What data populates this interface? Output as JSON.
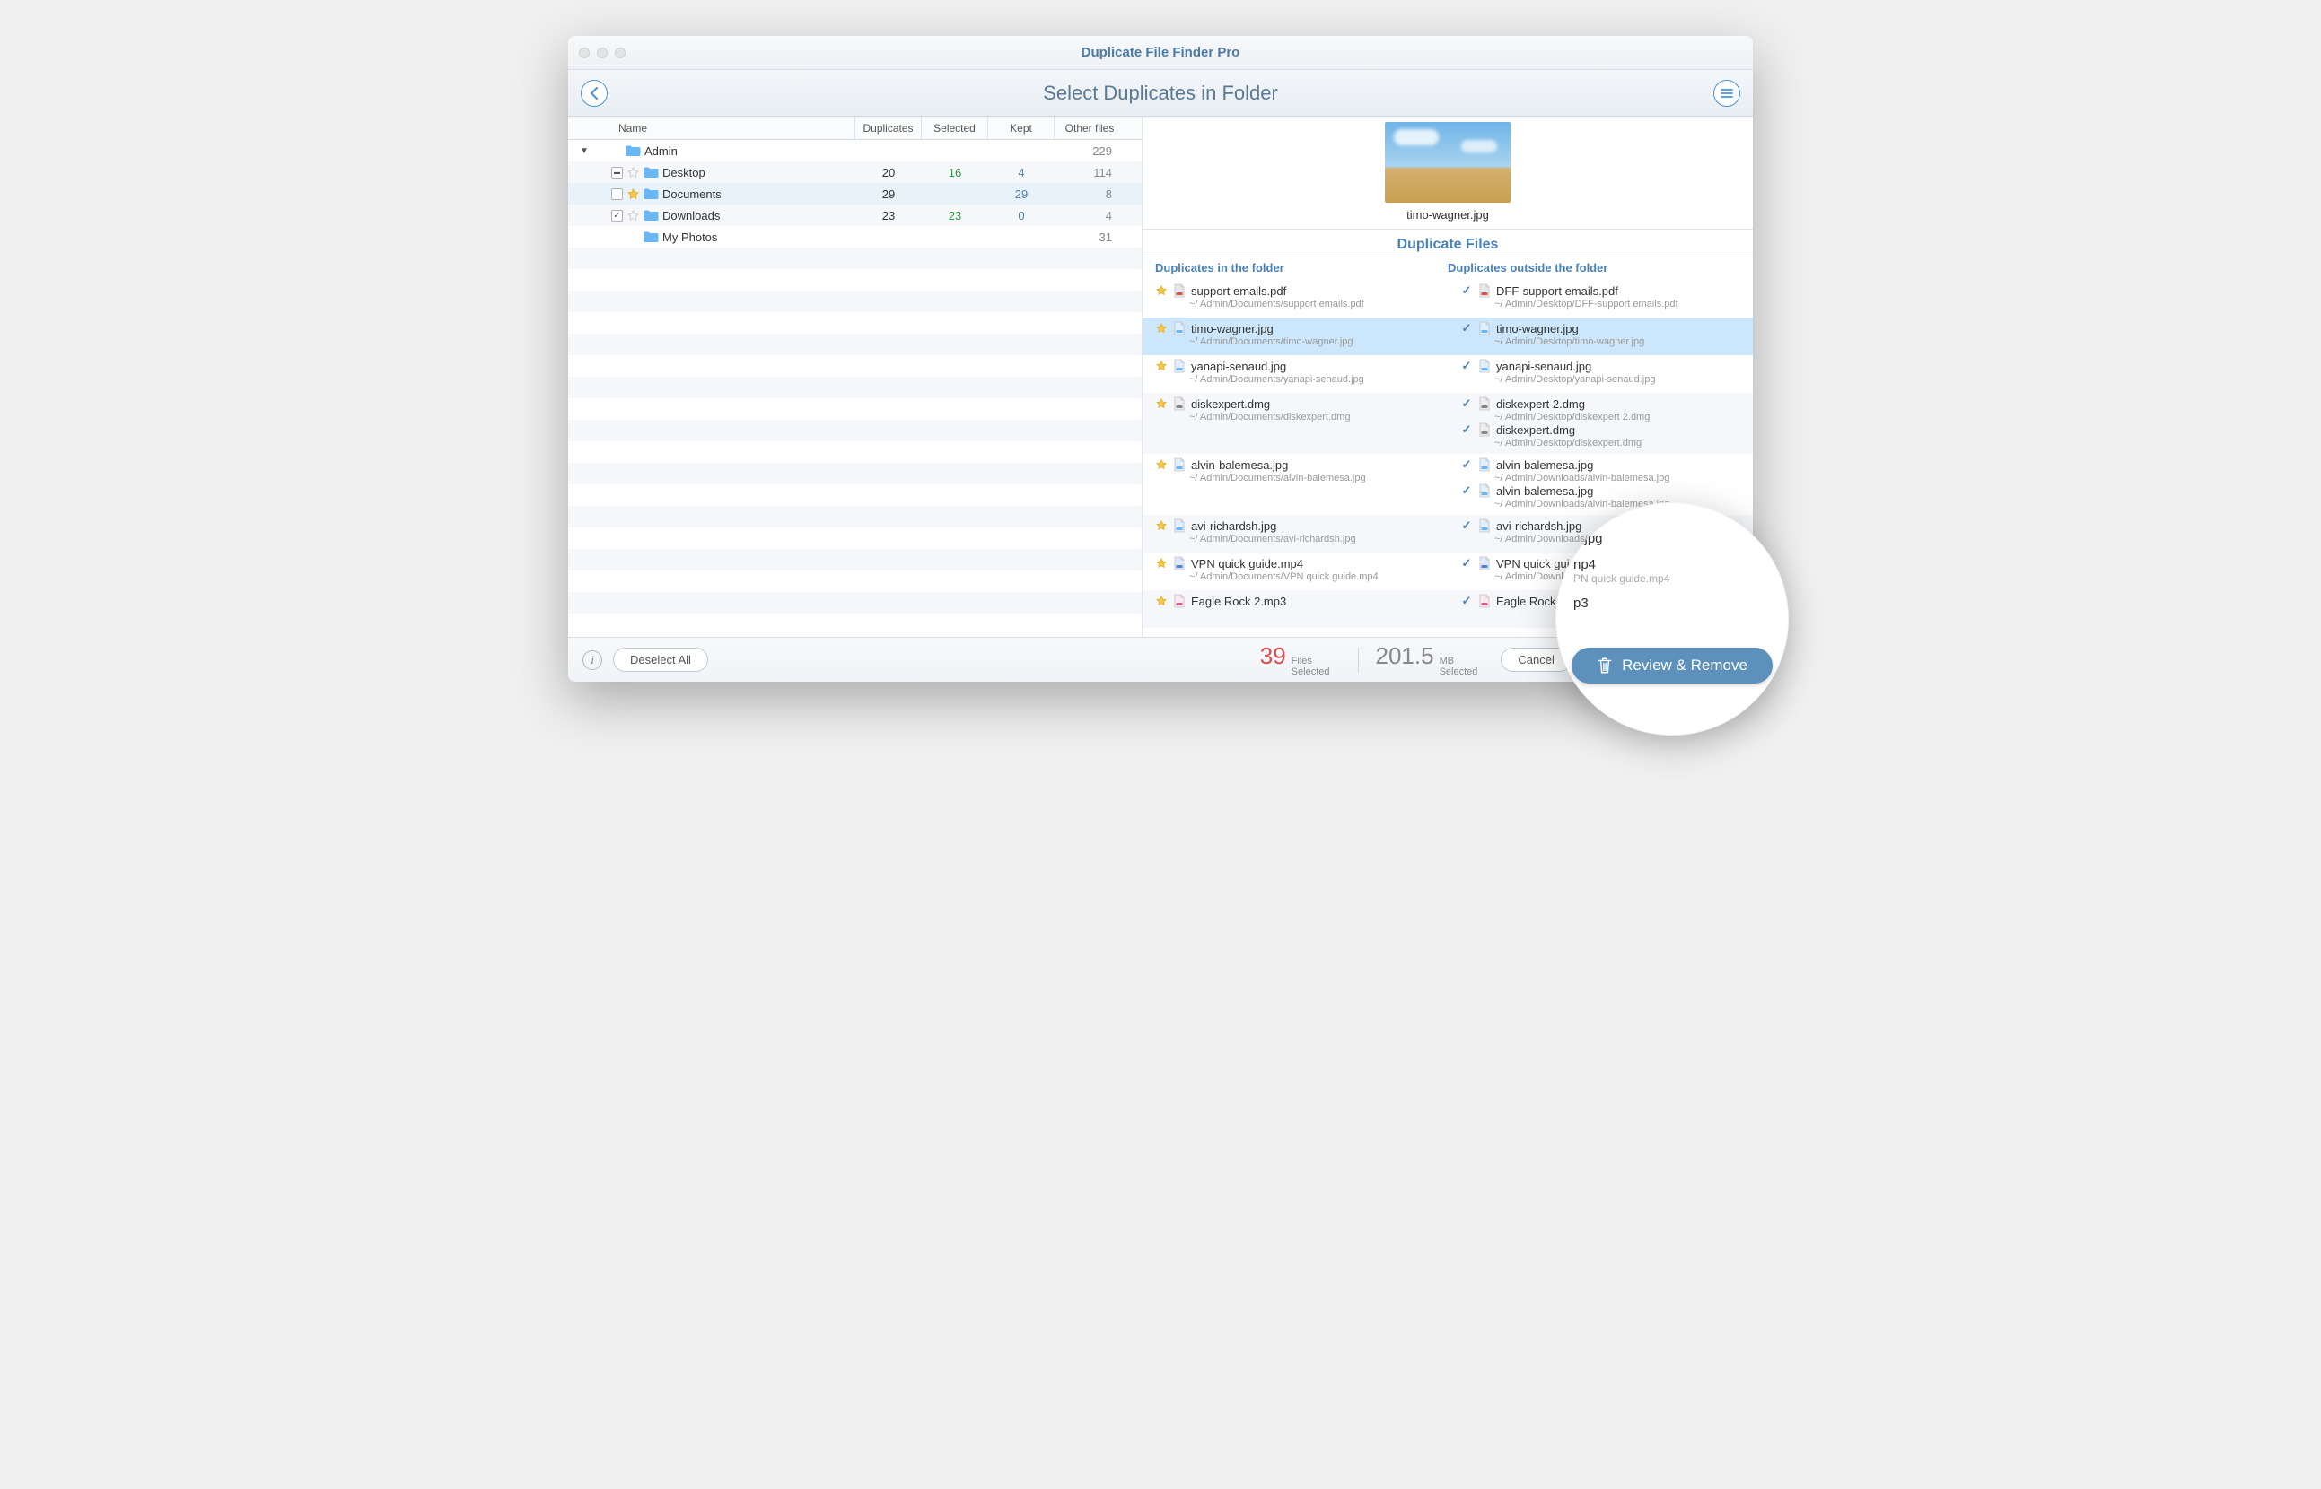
{
  "app_title": "Duplicate File Finder Pro",
  "toolbar": {
    "title": "Select Duplicates in Folder"
  },
  "table": {
    "headers": {
      "name": "Name",
      "duplicates": "Duplicates",
      "selected": "Selected",
      "kept": "Kept",
      "other": "Other files"
    },
    "rows": [
      {
        "name": "Admin",
        "indent": 0,
        "disclosure": "▼",
        "checkbox": "none",
        "star": "none",
        "dup": "",
        "sel": "",
        "kept": "",
        "other": "229"
      },
      {
        "name": "Desktop",
        "indent": 1,
        "disclosure": "",
        "checkbox": "mixed",
        "star": "empty",
        "dup": "20",
        "sel": "16",
        "kept": "4",
        "other": "114"
      },
      {
        "name": "Documents",
        "indent": 1,
        "disclosure": "",
        "checkbox": "unchecked",
        "star": "filled",
        "dup": "29",
        "sel": "",
        "kept": "29",
        "other": "8",
        "highlighted": true
      },
      {
        "name": "Downloads",
        "indent": 1,
        "disclosure": "",
        "checkbox": "checked",
        "star": "empty",
        "dup": "23",
        "sel": "23",
        "kept": "0",
        "other": "4"
      },
      {
        "name": "My Photos",
        "indent": 1,
        "disclosure": "",
        "checkbox": "none",
        "star": "none",
        "dup": "",
        "sel": "",
        "kept": "",
        "other": "31"
      }
    ]
  },
  "preview": {
    "filename": "timo-wagner.jpg"
  },
  "duplicates": {
    "heading": "Duplicate Files",
    "col_in": "Duplicates in the folder",
    "col_out": "Duplicates outside the folder",
    "rows": [
      {
        "in": [
          {
            "icon": "star",
            "type": "pdf",
            "name": "support emails.pdf",
            "path": "~/ Admin/Documents/support emails.pdf"
          }
        ],
        "out": [
          {
            "icon": "check",
            "type": "pdf",
            "name": "DFF-support emails.pdf",
            "path": "~/ Admin/Desktop/DFF-support emails.pdf"
          }
        ]
      },
      {
        "highlighted": true,
        "in": [
          {
            "icon": "star",
            "type": "img",
            "name": "timo-wagner.jpg",
            "path": "~/ Admin/Documents/timo-wagner.jpg"
          }
        ],
        "out": [
          {
            "icon": "check",
            "type": "img",
            "name": "timo-wagner.jpg",
            "path": "~/ Admin/Desktop/timo-wagner.jpg"
          }
        ]
      },
      {
        "in": [
          {
            "icon": "star",
            "type": "img",
            "name": "yanapi-senaud.jpg",
            "path": "~/ Admin/Documents/yanapi-senaud.jpg"
          }
        ],
        "out": [
          {
            "icon": "check",
            "type": "img",
            "name": "yanapi-senaud.jpg",
            "path": "~/ Admin/Desktop/yanapi-senaud.jpg"
          }
        ]
      },
      {
        "in": [
          {
            "icon": "star",
            "type": "dmg",
            "name": "diskexpert.dmg",
            "path": "~/ Admin/Documents/diskexpert.dmg"
          }
        ],
        "out": [
          {
            "icon": "check",
            "type": "dmg",
            "name": "diskexpert 2.dmg",
            "path": "~/ Admin/Desktop/diskexpert 2.dmg"
          },
          {
            "icon": "check",
            "type": "dmg",
            "name": "diskexpert.dmg",
            "path": "~/ Admin/Desktop/diskexpert.dmg"
          }
        ]
      },
      {
        "in": [
          {
            "icon": "star",
            "type": "img",
            "name": "alvin-balemesa.jpg",
            "path": "~/ Admin/Documents/alvin-balemesa.jpg"
          }
        ],
        "out": [
          {
            "icon": "check",
            "type": "img",
            "name": "alvin-balemesa.jpg",
            "path": "~/ Admin/Downloads/alvin-balemesa.jpg"
          },
          {
            "icon": "check",
            "type": "img",
            "name": "alvin-balemesa.jpg",
            "path": "~/ Admin/Downloads/alvin-balemesa.jpg"
          }
        ]
      },
      {
        "in": [
          {
            "icon": "star",
            "type": "img",
            "name": "avi-richardsh.jpg",
            "path": "~/ Admin/Documents/avi-richardsh.jpg"
          }
        ],
        "out": [
          {
            "icon": "check",
            "type": "img",
            "name": "avi-richardsh.jpg",
            "path": "~/ Admin/Downloads/avi-richardsh.jpg"
          }
        ]
      },
      {
        "in": [
          {
            "icon": "star",
            "type": "vid",
            "name": "VPN quick guide.mp4",
            "path": "~/ Admin/Documents/VPN quick guide.mp4"
          }
        ],
        "out": [
          {
            "icon": "check",
            "type": "vid",
            "name": "VPN quick guide.mp4",
            "path": "~/ Admin/Downloads/VPN quick guide.mp4"
          }
        ]
      },
      {
        "in": [
          {
            "icon": "star",
            "type": "aud",
            "name": "Eagle Rock 2.mp3",
            "path": ""
          }
        ],
        "out": [
          {
            "icon": "check",
            "type": "aud",
            "name": "Eagle Rock.mp3",
            "path": ""
          }
        ]
      }
    ]
  },
  "magnifier": {
    "items": [
      {
        "name": "n.jpg",
        "path": ""
      },
      {
        "name": "np4",
        "path": "PN quick guide.mp4"
      },
      {
        "name": "p3",
        "path": ""
      }
    ]
  },
  "footer": {
    "deselect": "Deselect All",
    "files_count": "39",
    "files_label1": "Files",
    "files_label2": "Selected",
    "size_value": "201.5",
    "size_label1": "MB",
    "size_label2": "Selected",
    "cancel": "Cancel",
    "review": "Review & Remove"
  }
}
